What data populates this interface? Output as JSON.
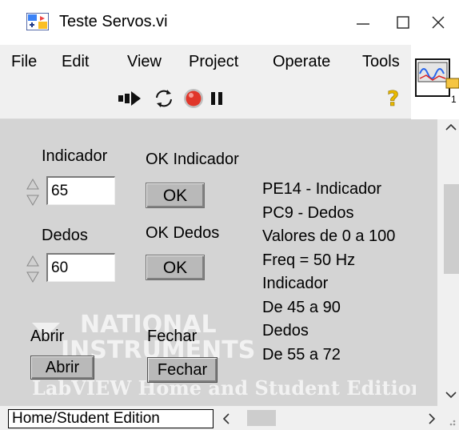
{
  "window": {
    "title": "Teste Servos.vi"
  },
  "menu": [
    "File",
    "Edit",
    "View",
    "Project",
    "Operate",
    "Tools"
  ],
  "controls": {
    "indicador": {
      "label": "Indicador",
      "value": "65"
    },
    "dedos": {
      "label": "Dedos",
      "value": "60"
    },
    "ok_indicador": {
      "label": "OK Indicador",
      "button": "OK"
    },
    "ok_dedos": {
      "label": "OK Dedos",
      "button": "OK"
    },
    "abrir": {
      "label": "Abrir",
      "button": "Abrir"
    },
    "fechar": {
      "label": "Fechar",
      "button": "Fechar"
    }
  },
  "notes": [
    "PE14 - Indicador",
    "PC9 - Dedos",
    "Valores de 0 a 100",
    "Freq = 50 Hz",
    "Indicador",
    "De 45 a 90",
    "Dedos",
    "De 55 a 72"
  ],
  "watermark": {
    "line1": "NATIONAL",
    "line2": "INSTRUMENTS",
    "line3": "LabVIEW Home and Student Edition"
  },
  "statusbar": {
    "edition": "Home/Student Edition"
  },
  "colors": {
    "panel": "#d4d4d4",
    "chrome": "#f0f0f0",
    "abort": "#e0362a",
    "help": "#f0c000"
  }
}
